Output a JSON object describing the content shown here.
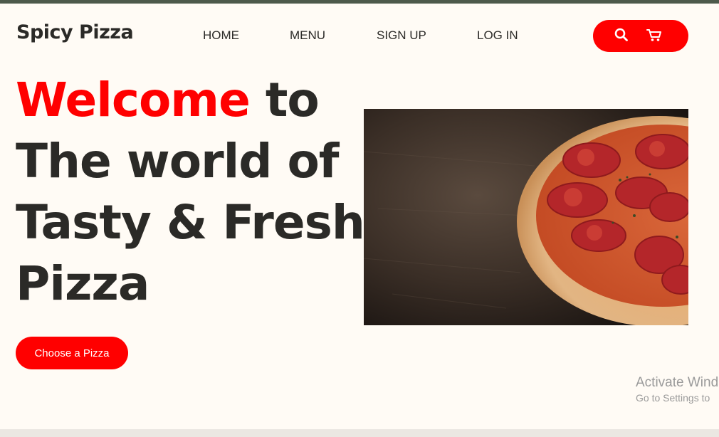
{
  "brand": {
    "name": "Spicy Pizza"
  },
  "nav": {
    "items": [
      "HOME",
      "MENU",
      "SIGN UP",
      "LOG IN"
    ]
  },
  "icons": {
    "search": "search-icon",
    "cart": "cart-icon"
  },
  "hero": {
    "heading_accent": "Welcome",
    "heading_after_accent": " to",
    "heading_line2": "The world of",
    "heading_line3": "Tasty & Fresh",
    "heading_line4": "Pizza",
    "cta_label": "Choose a Pizza",
    "image": "pepperoni-pizza-on-wooden-table"
  },
  "watermark": {
    "line1": "Activate Wind",
    "line2": "Go to Settings to"
  },
  "colors": {
    "accent": "#ff0000",
    "text": "#2b2a27",
    "background": "#fffbf5"
  }
}
